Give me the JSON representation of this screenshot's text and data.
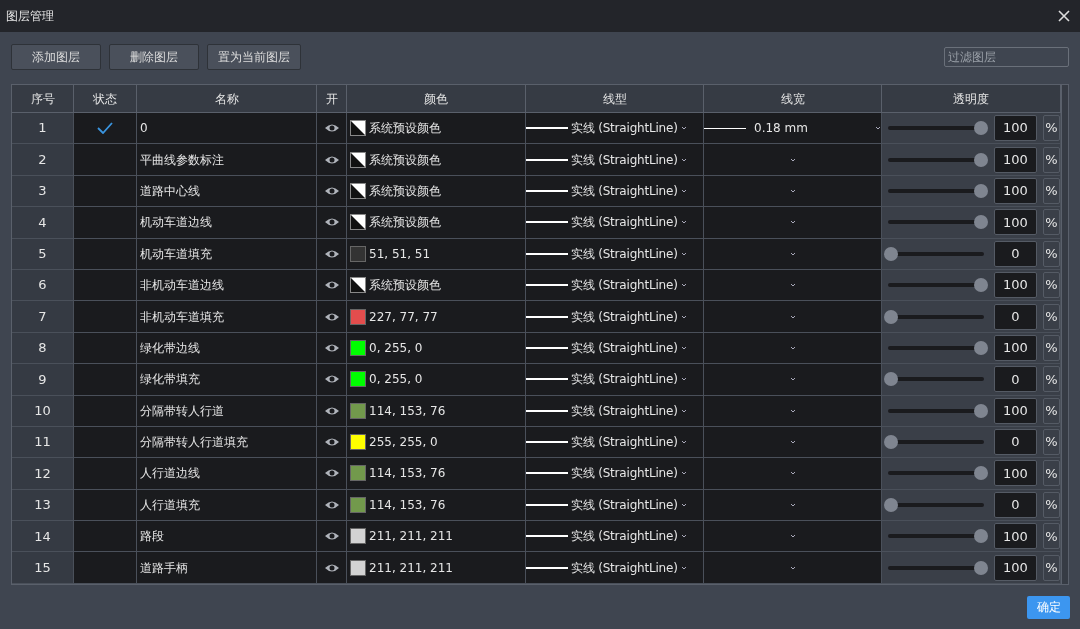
{
  "window": {
    "title": "图层管理"
  },
  "toolbar": {
    "buttons": [
      "添加图层",
      "删除图层",
      "置为当前图层"
    ],
    "filter": {
      "placeholder": "过滤图层"
    }
  },
  "table": {
    "columns": [
      "序号",
      "状态",
      "名称",
      "开",
      "颜色",
      "线型",
      "线宽",
      "透明度"
    ],
    "rows": [
      {
        "index": "1",
        "current": true,
        "name": "0",
        "visible": true,
        "color": {
          "kind": "default",
          "text": "系统预设颜色"
        },
        "linetype": "实线 (StraightLine)",
        "linewidth": "0.18 mm",
        "opacity": {
          "level": 1,
          "value": "100",
          "unit": "%"
        }
      },
      {
        "index": "2",
        "current": false,
        "name": "平曲线参数标注",
        "visible": true,
        "color": {
          "kind": "default",
          "text": "系统预设颜色"
        },
        "linetype": "实线 (StraightLine)",
        "opacity": {
          "level": 1,
          "value": "100",
          "unit": "%"
        }
      },
      {
        "index": "3",
        "current": false,
        "name": "道路中心线",
        "visible": true,
        "color": {
          "kind": "default",
          "text": "系统预设颜色"
        },
        "linetype": "实线 (StraightLine)",
        "opacity": {
          "level": 1,
          "value": "100",
          "unit": "%"
        }
      },
      {
        "index": "4",
        "current": false,
        "name": "机动车道边线",
        "visible": true,
        "color": {
          "kind": "default",
          "text": "系统预设颜色"
        },
        "linetype": "实线 (StraightLine)",
        "opacity": {
          "level": 1,
          "value": "100",
          "unit": "%"
        }
      },
      {
        "index": "5",
        "current": false,
        "name": "机动车道填充",
        "visible": true,
        "color": {
          "kind": "rgb",
          "text": "51, 51, 51",
          "color": "#333333"
        },
        "linetype": "实线 (StraightLine)",
        "opacity": {
          "level": 0,
          "value": "0",
          "unit": "%"
        }
      },
      {
        "index": "6",
        "current": false,
        "name": "非机动车道边线",
        "visible": true,
        "color": {
          "kind": "default",
          "text": "系统预设颜色"
        },
        "linetype": "实线 (StraightLine)",
        "opacity": {
          "level": 1,
          "value": "100",
          "unit": "%"
        }
      },
      {
        "index": "7",
        "current": false,
        "name": "非机动车道填充",
        "visible": true,
        "color": {
          "kind": "rgb",
          "text": "227, 77, 77",
          "color": "#e34d4d"
        },
        "linetype": "实线 (StraightLine)",
        "opacity": {
          "level": 0,
          "value": "0",
          "unit": "%"
        }
      },
      {
        "index": "8",
        "current": false,
        "name": "绿化带边线",
        "visible": true,
        "color": {
          "kind": "rgb",
          "text": "0, 255, 0",
          "color": "#00ff00"
        },
        "linetype": "实线 (StraightLine)",
        "opacity": {
          "level": 1,
          "value": "100",
          "unit": "%"
        }
      },
      {
        "index": "9",
        "current": false,
        "name": "绿化带填充",
        "visible": true,
        "color": {
          "kind": "rgb",
          "text": "0, 255, 0",
          "color": "#00ff00"
        },
        "linetype": "实线 (StraightLine)",
        "opacity": {
          "level": 0,
          "value": "0",
          "unit": "%"
        }
      },
      {
        "index": "10",
        "current": false,
        "name": "分隔带转人行道",
        "visible": true,
        "color": {
          "kind": "rgb",
          "text": "114, 153, 76",
          "color": "#72994c"
        },
        "linetype": "实线 (StraightLine)",
        "opacity": {
          "level": 1,
          "value": "100",
          "unit": "%"
        }
      },
      {
        "index": "11",
        "current": false,
        "name": "分隔带转人行道填充",
        "visible": true,
        "color": {
          "kind": "rgb",
          "text": "255, 255, 0",
          "color": "#ffff00"
        },
        "linetype": "实线 (StraightLine)",
        "opacity": {
          "level": 0,
          "value": "0",
          "unit": "%"
        }
      },
      {
        "index": "12",
        "current": false,
        "name": "人行道边线",
        "visible": true,
        "color": {
          "kind": "rgb",
          "text": "114, 153, 76",
          "color": "#72994c"
        },
        "linetype": "实线 (StraightLine)",
        "opacity": {
          "level": 1,
          "value": "100",
          "unit": "%"
        }
      },
      {
        "index": "13",
        "current": false,
        "name": "人行道填充",
        "visible": true,
        "color": {
          "kind": "rgb",
          "text": "114, 153, 76",
          "color": "#72994c"
        },
        "linetype": "实线 (StraightLine)",
        "opacity": {
          "level": 0,
          "value": "0",
          "unit": "%"
        }
      },
      {
        "index": "14",
        "current": false,
        "name": "路段",
        "visible": true,
        "color": {
          "kind": "rgb",
          "text": "211, 211, 211",
          "color": "#d3d3d3"
        },
        "linetype": "实线 (StraightLine)",
        "opacity": {
          "level": 1,
          "value": "100",
          "unit": "%"
        }
      },
      {
        "index": "15",
        "current": false,
        "name": "道路手柄",
        "visible": true,
        "color": {
          "kind": "rgb",
          "text": "211, 211, 211",
          "color": "#d3d3d3"
        },
        "linetype": "实线 (StraightLine)",
        "opacity": {
          "level": 1,
          "value": "100",
          "unit": "%"
        }
      }
    ]
  },
  "footer": {
    "confirm": "确定"
  }
}
